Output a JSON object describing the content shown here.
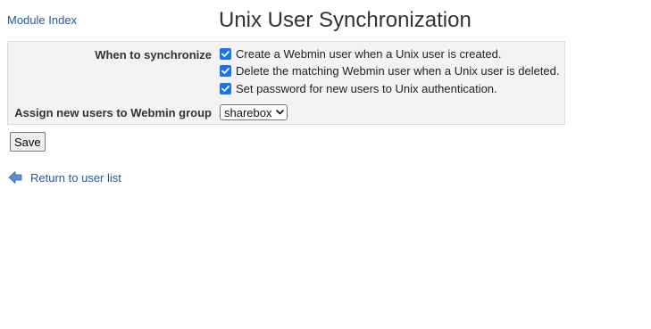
{
  "header": {
    "module_index_label": "Module Index",
    "title": "Unix User Synchronization"
  },
  "form": {
    "when_label": "When to synchronize",
    "options": [
      {
        "label": "Create a Webmin user when a Unix user is created.",
        "checked": true
      },
      {
        "label": "Delete the matching Webmin user when a Unix user is deleted.",
        "checked": true
      },
      {
        "label": "Set password for new users to Unix authentication.",
        "checked": true
      }
    ],
    "group_label": "Assign new users to Webmin group",
    "group_value": "sharebox"
  },
  "actions": {
    "save_label": "Save"
  },
  "footer": {
    "return_label": "Return to user list",
    "return_icon": "left-arrow-icon"
  },
  "colors": {
    "link": "#1e5a9c",
    "checkbox": "#1a73e8",
    "panel_bg": "#f3f3f3"
  }
}
